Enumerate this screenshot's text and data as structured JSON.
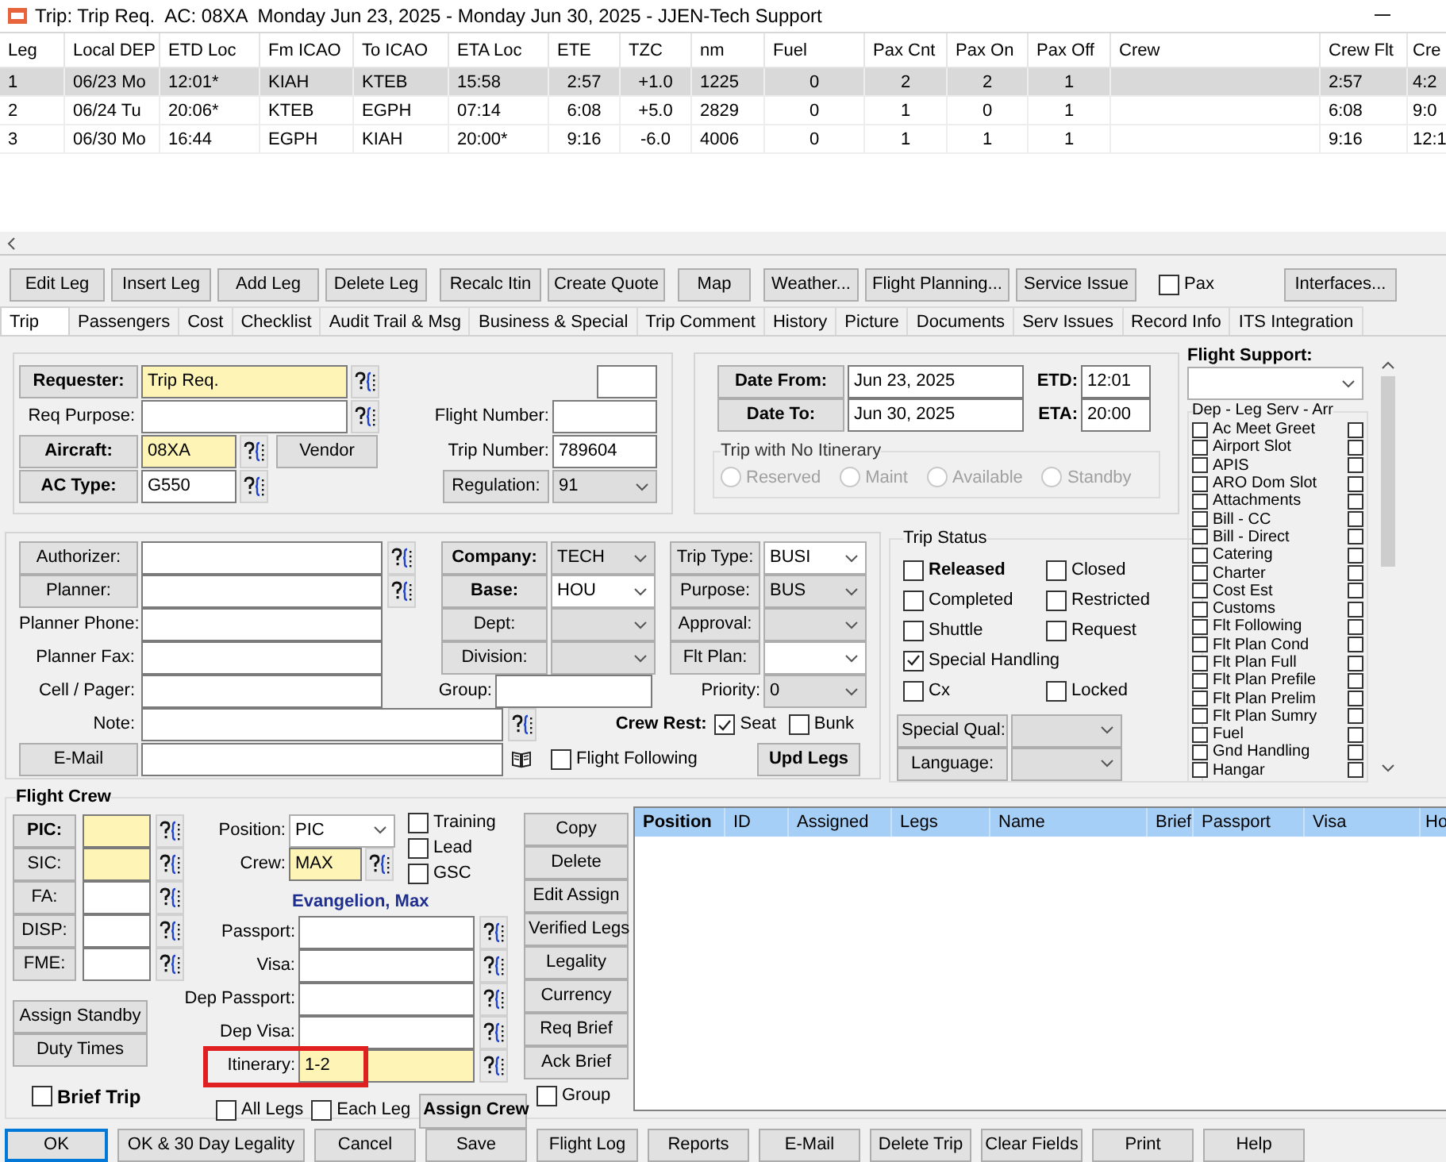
{
  "window": {
    "title": "Trip: Trip Req.  AC: 08XA  Monday Jun 23, 2025 - Monday Jun 30, 2025 - JJEN-Tech Support"
  },
  "legs": {
    "columns": [
      "Leg",
      "Local DEP",
      "ETD Loc",
      "Fm ICAO",
      "To ICAO",
      "ETA Loc",
      "ETE",
      "TZC",
      "nm",
      "Fuel",
      "Pax Cnt",
      "Pax On",
      "Pax Off",
      "Crew",
      "Crew Flt",
      "Cre"
    ],
    "rows": [
      {
        "selected": true,
        "cells": [
          "1",
          "06/23 Mo",
          "12:01*",
          "KIAH",
          "KTEB",
          "15:58",
          "2:57",
          "+1.0",
          "1225",
          "0",
          "2",
          "2",
          "1",
          null,
          "2:57",
          "4:2"
        ]
      },
      {
        "selected": false,
        "cells": [
          "2",
          "06/24 Tu",
          "20:06*",
          "KTEB",
          "EGPH",
          "07:14",
          "6:08",
          "+5.0",
          "2829",
          "0",
          "1",
          "0",
          "1",
          null,
          "6:08",
          "9:0"
        ]
      },
      {
        "selected": false,
        "cells": [
          "3",
          "06/30 Mo",
          "16:44",
          "EGPH",
          "KIAH",
          "20:00*",
          "9:16",
          "-6.0",
          "4006",
          "0",
          "1",
          "1",
          "1",
          null,
          "9:16",
          "12:1"
        ]
      }
    ]
  },
  "toolbar": {
    "buttons": [
      "Edit Leg",
      "Insert Leg",
      "Add Leg",
      "Delete Leg",
      "Recalc Itin",
      "Create Quote",
      "Map",
      "Weather...",
      "Flight Planning...",
      "Service Issue"
    ],
    "pax": {
      "label": "Pax",
      "checked": false
    },
    "interfaces": "Interfaces..."
  },
  "tabs": [
    {
      "label": "Trip",
      "selected": true
    },
    {
      "label": "Passengers",
      "selected": false
    },
    {
      "label": "Cost",
      "selected": false
    },
    {
      "label": "Checklist",
      "selected": false
    },
    {
      "label": "Audit Trail & Msg",
      "selected": false
    },
    {
      "label": "Business & Special",
      "selected": false
    },
    {
      "label": "Trip Comment",
      "selected": false
    },
    {
      "label": "History",
      "selected": false
    },
    {
      "label": "Picture",
      "selected": false
    },
    {
      "label": "Documents",
      "selected": false
    },
    {
      "label": "Serv Issues",
      "selected": false
    },
    {
      "label": "Record Info",
      "selected": false
    },
    {
      "label": "ITS Integration",
      "selected": false
    }
  ],
  "trip": {
    "rows": [
      {
        "label": "Requester:",
        "kind": "button",
        "required": true,
        "value": "Trip Req.",
        "highlighted": true
      },
      {
        "label": "Req Purpose:",
        "kind": "text",
        "required": false,
        "highlighted": false
      },
      {
        "label": "Aircraft:",
        "kind": "button",
        "required": true,
        "value": "08XA",
        "highlighted": true,
        "extra_button": "Vendor"
      },
      {
        "label": "AC Type:",
        "kind": "button",
        "required": true,
        "value": "G550",
        "highlighted": false
      }
    ],
    "flight_number": {
      "label": "Flight Number:"
    },
    "trip_number": {
      "label": "Trip Number:",
      "value": "789604"
    },
    "regulation": {
      "label": "Regulation:",
      "value": "91",
      "read_only": true
    }
  },
  "dates": {
    "rows": [
      {
        "label": "Date From:",
        "value": "Jun 23, 2025",
        "time_label": "ETD:",
        "time": "12:01"
      },
      {
        "label": "Date To:",
        "value": "Jun 30, 2025",
        "time_label": "ETA:",
        "time": "20:00"
      }
    ],
    "no_itinerary": {
      "title": "Trip with No Itinerary",
      "disabled": true,
      "options": [
        {
          "label": "Reserved",
          "selected": false
        },
        {
          "label": "Maint",
          "selected": false
        },
        {
          "label": "Available",
          "selected": false
        },
        {
          "label": "Standby",
          "selected": false
        }
      ]
    }
  },
  "contacts": [
    {
      "label": "Authorizer:",
      "kind": "button",
      "lookup": true
    },
    {
      "label": "Planner:",
      "kind": "button",
      "lookup": true
    },
    {
      "label": "Planner Phone:",
      "kind": "text",
      "lookup": false
    },
    {
      "label": "Planner Fax:",
      "kind": "text",
      "lookup": false
    },
    {
      "label": "Cell / Pager:",
      "kind": "text",
      "lookup": false
    }
  ],
  "company_fields": [
    {
      "label": "Company:",
      "required": true,
      "value": "TECH",
      "read_only": true
    },
    {
      "label": "Base:",
      "required": true,
      "value": "HOU",
      "read_only": false
    },
    {
      "label": "Dept:",
      "required": false,
      "read_only": true
    },
    {
      "label": "Division:",
      "required": false,
      "read_only": true
    }
  ],
  "group": {
    "label": "Group:"
  },
  "trip_fields": [
    {
      "label": "Trip Type:",
      "kind": "button",
      "value": "BUSI",
      "read_only": false
    },
    {
      "label": "Purpose:",
      "kind": "button",
      "value": "BUS",
      "read_only": true
    },
    {
      "label": "Approval:",
      "kind": "button",
      "read_only": true
    },
    {
      "label": "Flt Plan:",
      "kind": "button",
      "read_only": false
    },
    {
      "label": "Priority:",
      "kind": "text",
      "value": "0",
      "read_only": true
    }
  ],
  "note": {
    "label": "Note:"
  },
  "email": {
    "label": "E-Mail"
  },
  "flight_following": {
    "label": "Flight Following",
    "checked": false
  },
  "crew_rest": {
    "label": "Crew Rest:",
    "options": [
      {
        "label": "Seat",
        "checked": true
      },
      {
        "label": "Bunk",
        "checked": false
      }
    ]
  },
  "upd_legs": "Upd Legs",
  "trip_status": {
    "title": "Trip Status",
    "rows": [
      [
        {
          "label": "Released",
          "checked": false,
          "required": true
        },
        {
          "label": "Closed",
          "checked": false,
          "required": false
        }
      ],
      [
        {
          "label": "Completed",
          "checked": false,
          "required": false
        },
        {
          "label": "Restricted",
          "checked": false,
          "required": false
        }
      ],
      [
        {
          "label": "Shuttle",
          "checked": false,
          "required": false
        },
        {
          "label": "Request",
          "checked": false,
          "required": false
        }
      ],
      [
        {
          "label": "Special Handling",
          "checked": true,
          "required": false
        }
      ],
      [
        {
          "label": "Cx",
          "checked": false,
          "required": false
        },
        {
          "label": "Locked",
          "checked": false,
          "required": false
        }
      ]
    ],
    "fields": [
      {
        "label": "Special Qual:"
      },
      {
        "label": "Language:"
      }
    ]
  },
  "flight_support": {
    "title": "Flight Support:",
    "group": "Dep - Leg Serv - Arr",
    "services": [
      {
        "label": "Ac Meet Greet",
        "dep": false,
        "arr": false
      },
      {
        "label": "Airport Slot",
        "dep": false,
        "arr": false
      },
      {
        "label": "APIS",
        "dep": false,
        "arr": false
      },
      {
        "label": "ARO Dom Slot",
        "dep": false,
        "arr": false
      },
      {
        "label": "Attachments",
        "dep": false,
        "arr": false
      },
      {
        "label": "Bill - CC",
        "dep": false,
        "arr": false
      },
      {
        "label": "Bill - Direct",
        "dep": false,
        "arr": false
      },
      {
        "label": "Catering",
        "dep": false,
        "arr": false
      },
      {
        "label": "Charter",
        "dep": false,
        "arr": false
      },
      {
        "label": "Cost Est",
        "dep": false,
        "arr": false
      },
      {
        "label": "Customs",
        "dep": false,
        "arr": false
      },
      {
        "label": "Flt Following",
        "dep": false,
        "arr": false
      },
      {
        "label": "Flt Plan Cond",
        "dep": false,
        "arr": false
      },
      {
        "label": "Flt Plan Full",
        "dep": false,
        "arr": false
      },
      {
        "label": "Flt Plan Prefile",
        "dep": false,
        "arr": false
      },
      {
        "label": "Flt Plan Prelim",
        "dep": false,
        "arr": false
      },
      {
        "label": "Flt Plan Sumry",
        "dep": false,
        "arr": false
      },
      {
        "label": "Fuel",
        "dep": false,
        "arr": false
      },
      {
        "label": "Gnd Handling",
        "dep": false,
        "arr": false
      },
      {
        "label": "Hangar",
        "dep": false,
        "arr": false
      }
    ]
  },
  "flight_crew": {
    "title": "Flight Crew",
    "roles": [
      {
        "label": "PIC:",
        "required": true,
        "highlighted": true
      },
      {
        "label": "SIC:",
        "required": false,
        "highlighted": true
      },
      {
        "label": "FA:",
        "required": false,
        "highlighted": false
      },
      {
        "label": "DISP:",
        "required": false,
        "highlighted": false
      },
      {
        "label": "FME:",
        "required": false,
        "highlighted": false
      }
    ],
    "position": {
      "label": "Position:",
      "value": "PIC"
    },
    "crew": {
      "label": "Crew:",
      "value": "MAX",
      "highlighted": true
    },
    "flags": [
      {
        "label": "Training",
        "checked": false
      },
      {
        "label": "Lead",
        "checked": false
      },
      {
        "label": "GSC",
        "checked": false
      }
    ],
    "crew_name": "Evangelion, Max",
    "documents": [
      {
        "label": "Passport:",
        "highlighted": false,
        "marked": false
      },
      {
        "label": "Visa:",
        "highlighted": false,
        "marked": false
      },
      {
        "label": "Dep Passport:",
        "highlighted": false,
        "marked": false
      },
      {
        "label": "Dep Visa:",
        "highlighted": false,
        "marked": false
      },
      {
        "label": "Itinerary:",
        "value": "1-2",
        "highlighted": true,
        "marked": true
      }
    ],
    "side_buttons": [
      "Assign Standby",
      "Duty Times"
    ],
    "brief_trip": {
      "label": "Brief Trip",
      "checked": false
    },
    "leg_scope": [
      {
        "label": "All Legs",
        "checked": false
      },
      {
        "label": "Each Leg",
        "checked": false
      }
    ],
    "assign_crew": "Assign Crew",
    "actions": [
      "Copy",
      "Delete",
      "Edit Assign",
      "Verified Legs",
      "Legality",
      "Currency",
      "Req Brief",
      "Ack Brief"
    ],
    "group": {
      "label": "Group",
      "checked": false
    },
    "table": {
      "columns": [
        "Position",
        "ID",
        "Assigned",
        "Legs",
        "Name",
        "Brief",
        "Passport",
        "Visa",
        "Ho"
      ]
    }
  },
  "footer_buttons": [
    {
      "label": "OK",
      "default": true
    },
    {
      "label": "OK & 30 Day Legality",
      "default": false
    },
    {
      "label": "Cancel",
      "default": false
    },
    {
      "label": "Save",
      "default": false
    },
    {
      "label": "Flight Log",
      "default": false
    },
    {
      "label": "Reports",
      "default": false
    },
    {
      "label": "E-Mail",
      "default": false
    },
    {
      "label": "Delete Trip",
      "default": false
    },
    {
      "label": "Clear Fields",
      "default": false
    },
    {
      "label": "Print",
      "default": false
    },
    {
      "label": "Help",
      "default": false
    }
  ]
}
